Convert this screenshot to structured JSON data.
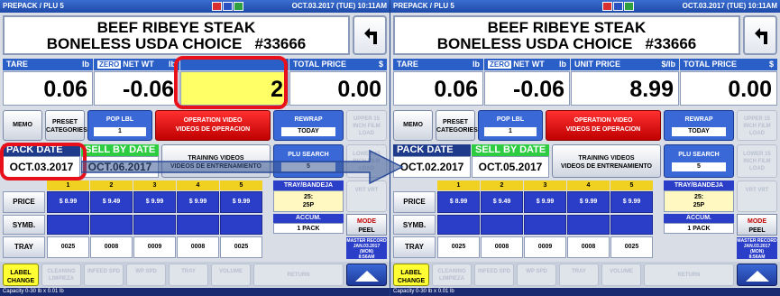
{
  "screens": {
    "left": {
      "window_title": "PREPACK / PLU 5",
      "datetime": "OCT.03.2017 (TUE)  10:11AM",
      "product_name_line1": "BEEF RIBEYE STEAK",
      "product_name_line2": "BONELESS USDA CHOICE",
      "plu_number": "#33666",
      "tare_label": "TARE",
      "tare_unit": "lb",
      "tare_value": "0.06",
      "zero_badge": "ZERO",
      "net_wt_label": "NET WT",
      "net_wt_unit": "lb",
      "net_wt_value": "-0.06",
      "unit_price_label": "",
      "unit_price_unit": "",
      "unit_price_value": "2",
      "total_price_label": "TOTAL PRICE",
      "total_price_unit": "$",
      "total_price_value": "0.00",
      "memo_label": "MEMO",
      "preset_label": "PRESET",
      "categories_label": "CATEGORIES",
      "pop_lbl_label": "POP LBL",
      "pop_lbl_value": "1",
      "operation_video_label": "OPERATION VIDEO",
      "operation_video_sub": "VIDEOS DE OPERACION",
      "rewrap_label": "REWRAP",
      "rewrap_value": "TODAY",
      "upper_label": "UPPER 15 INCH FILM LOAD",
      "pack_date_label": "PACK DATE",
      "pack_date_value": "OCT.03.2017",
      "sell_by_label": "SELL BY DATE",
      "sell_by_value": "OCT.06.2017",
      "training_label": "TRAINING VIDEOS",
      "training_sub": "VIDEOS DE ENTRENAMIENTO",
      "plu_search_label": "PLU SEARCH",
      "plu_search_value": "5",
      "lower_label": "LOWER 15 INCH FILM LOAD",
      "prices": [
        "$ 8.99",
        "$ 9.49",
        "$ 9.99",
        "$ 9.99",
        "$ 9.99"
      ],
      "trays": [
        "0025",
        "0008",
        "0009",
        "0008",
        "0025"
      ],
      "columns": [
        "1",
        "2",
        "3",
        "4",
        "5"
      ],
      "price_label": "PRICE",
      "symb_label": "SYMB.",
      "tray_label": "TRAY",
      "tray_bandeja_label": "TRAY/BANDEJA",
      "tray_bandeja_value": "25:",
      "tray_bandeja_value2": "25P",
      "vert_label": "VRT VRT",
      "accum_label": "ACCUM.",
      "accum_value": "1 PACK",
      "mode_label": "MODE",
      "mode_value": "PEEL",
      "master_label": "MASTER RECORD",
      "master_date": "JAN.03.2017 (MON)",
      "master_time": "8:56AM",
      "label_change_label": "LABEL CHANGE",
      "cleaning_label": "CLEANING LIMPIEZA",
      "infeed_label": "INFEED SPD",
      "wp_spd_label": "WP SPD",
      "tray_btn_label": "TRAY",
      "volume_label": "VOLUME",
      "return_label": "RETURN",
      "capacity": "Capacity 0-30 lb x 0.01 lb"
    },
    "right": {
      "window_title": "PREPACK / PLU 5",
      "datetime": "OCT.03.2017 (TUE)  10:11AM",
      "product_name_line1": "BEEF RIBEYE STEAK",
      "product_name_line2": "BONELESS USDA CHOICE",
      "plu_number": "#33666",
      "tare_label": "TARE",
      "tare_unit": "lb",
      "tare_value": "0.06",
      "zero_badge": "ZERO",
      "net_wt_label": "NET WT",
      "net_wt_unit": "lb",
      "net_wt_value": "-0.06",
      "unit_price_label": "UNIT PRICE",
      "unit_price_unit": "$/lb",
      "unit_price_value": "8.99",
      "total_price_label": "TOTAL PRICE",
      "total_price_unit": "$",
      "total_price_value": "0.00",
      "memo_label": "MEMO",
      "preset_label": "PRESET",
      "categories_label": "CATEGORIES",
      "pop_lbl_label": "POP LBL",
      "pop_lbl_value": "1",
      "operation_video_label": "OPERATION VIDEO",
      "operation_video_sub": "VIDEOS DE OPERACION",
      "rewrap_label": "REWRAP",
      "rewrap_value": "TODAY",
      "upper_label": "UPPER 15 INCH FILM LOAD",
      "pack_date_label": "PACK DATE",
      "pack_date_value": "OCT.02.2017",
      "sell_by_label": "SELL BY DATE",
      "sell_by_value": "OCT.05.2017",
      "training_label": "TRAINING VIDEOS",
      "training_sub": "VIDEOS DE ENTRENAMIENTO",
      "plu_search_label": "PLU SEARCH",
      "plu_search_value": "5",
      "lower_label": "LOWER 15 INCH FILM LOAD",
      "prices": [
        "$ 8.99",
        "$ 9.49",
        "$ 9.99",
        "$ 9.99",
        "$ 9.99"
      ],
      "trays": [
        "0025",
        "0008",
        "0009",
        "0008",
        "0025"
      ],
      "columns": [
        "1",
        "2",
        "3",
        "4",
        "5"
      ],
      "price_label": "PRICE",
      "symb_label": "SYMB.",
      "tray_label": "TRAY",
      "tray_bandeja_label": "TRAY/BANDEJA",
      "tray_bandeja_value": "25:",
      "tray_bandeja_value2": "25P",
      "vert_label": "VRT VRT",
      "accum_label": "ACCUM.",
      "accum_value": "1 PACK",
      "mode_label": "MODE",
      "mode_value": "PEEL",
      "master_label": "MASTER RECORD",
      "master_date": "JAN.03.2017 (MON)",
      "master_time": "8:56AM",
      "label_change_label": "LABEL CHANGE",
      "cleaning_label": "CLEANING LIMPIEZA",
      "infeed_label": "INFEED SPD",
      "wp_spd_label": "WP SPD",
      "tray_btn_label": "TRAY",
      "volume_label": "VOLUME",
      "return_label": "RETURN",
      "capacity": "Capacity 0-30 lb x 0.01 lb"
    }
  },
  "colors": {
    "accent_blue": "#2b5fc8",
    "highlight_red": "#e8101a",
    "input_yellow": "#ffff66",
    "sell_by_green": "#2ecc40"
  }
}
